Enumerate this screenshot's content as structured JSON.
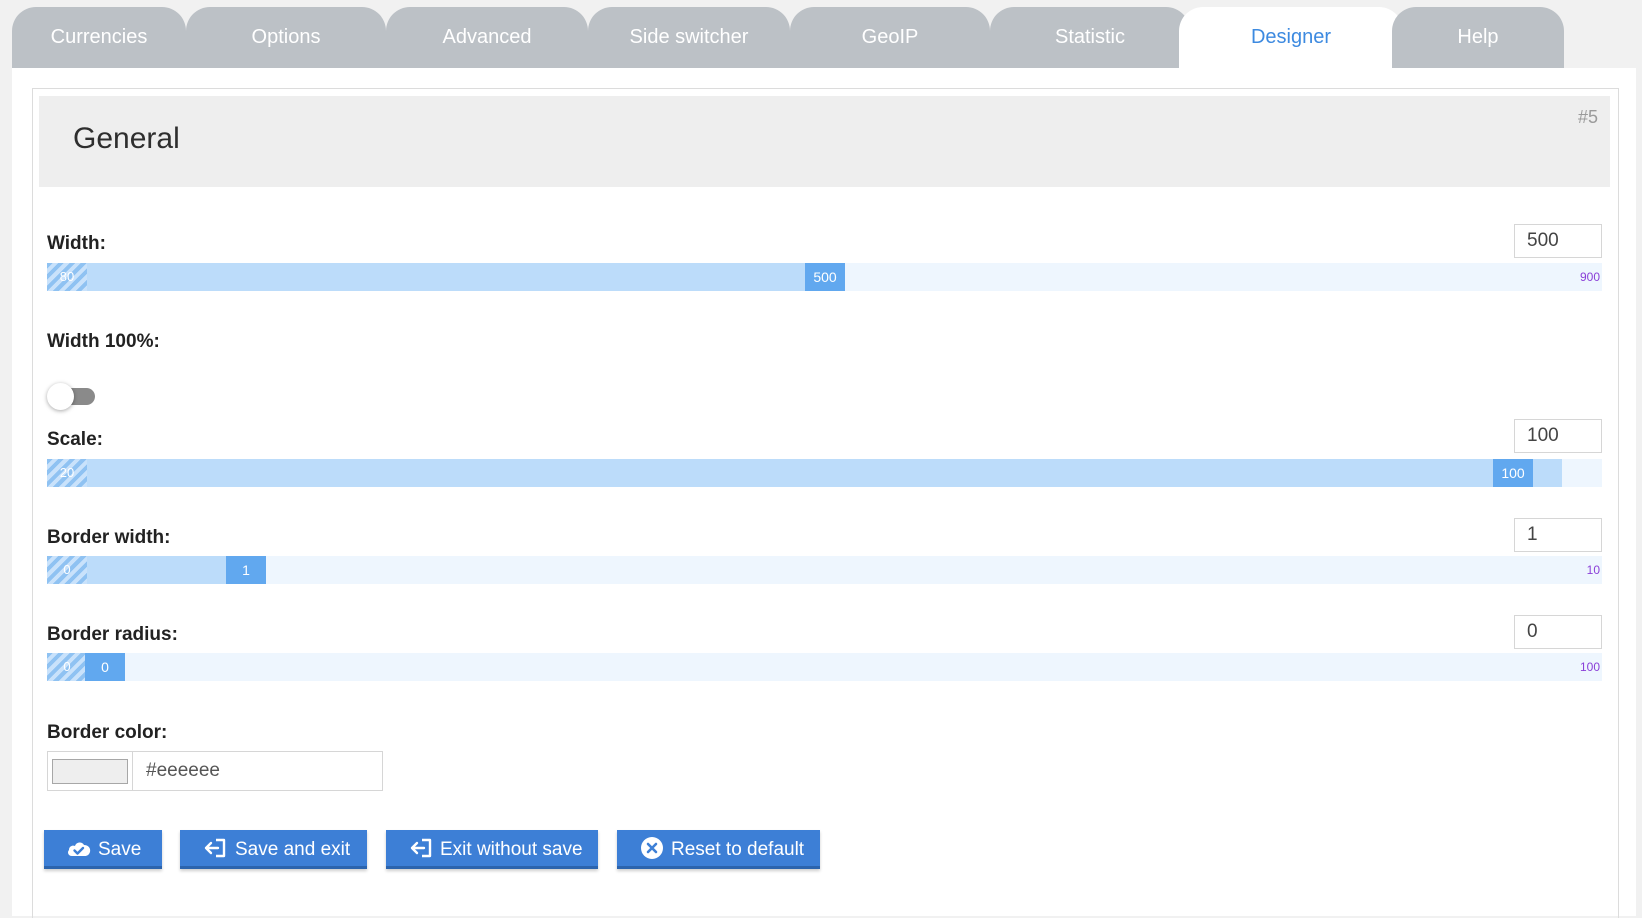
{
  "tabs": [
    {
      "label": "Currencies",
      "active": false
    },
    {
      "label": "Options",
      "active": false
    },
    {
      "label": "Advanced",
      "active": false
    },
    {
      "label": "Side switcher",
      "active": false
    },
    {
      "label": "GeoIP",
      "active": false
    },
    {
      "label": "Statistic",
      "active": false
    },
    {
      "label": "Designer",
      "active": true
    },
    {
      "label": "Help",
      "active": false
    }
  ],
  "section": {
    "title": "General",
    "number": "#5"
  },
  "fields": {
    "width": {
      "label": "Width:",
      "value": "500",
      "min": "80",
      "max": "900"
    },
    "width_full": {
      "label": "Width 100%:",
      "checked": false
    },
    "scale": {
      "label": "Scale:",
      "value": "100",
      "min": "20",
      "max": "100"
    },
    "border_width": {
      "label": "Border width:",
      "value": "1",
      "min": "0",
      "max": "10"
    },
    "border_radius": {
      "label": "Border radius:",
      "value": "0",
      "min": "0",
      "max": "100"
    },
    "border_color": {
      "label": "Border color:",
      "value": "#eeeeee",
      "swatch": "#eeeeee"
    }
  },
  "buttons": {
    "save": "Save",
    "save_exit": "Save and exit",
    "exit_no_save": "Exit without save",
    "reset": "Reset to default"
  },
  "colors": {
    "accent": "#3d7fd6",
    "tab_inactive": "#bcc1c6",
    "tab_active_text": "#3d8ae0",
    "slider_track": "#eef6fe",
    "slider_fill": "#bcdcfa",
    "slider_handle": "#61a8ef",
    "slider_max_text": "#8a3fd8"
  }
}
